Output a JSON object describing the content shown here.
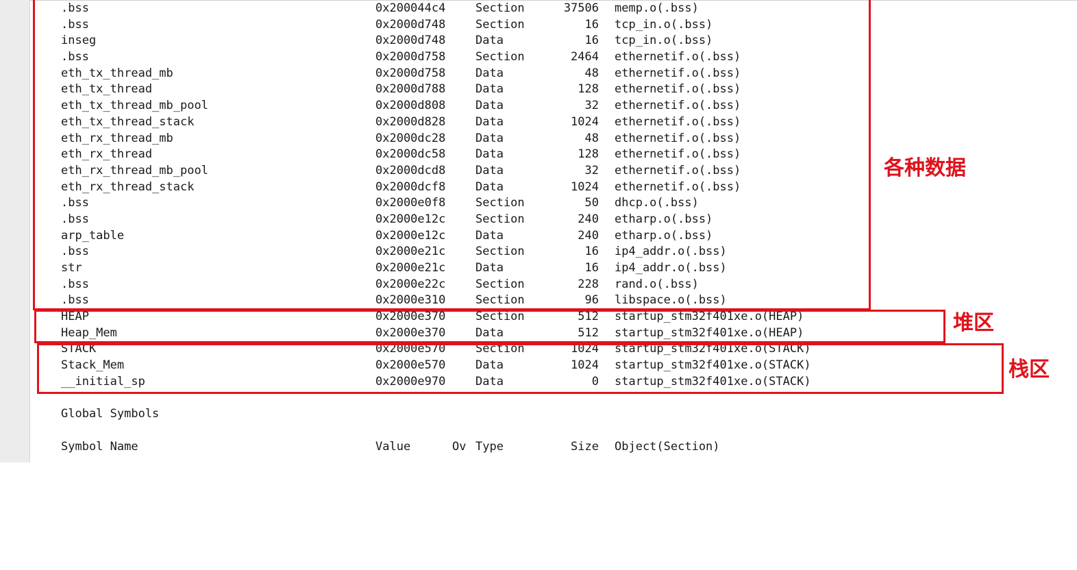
{
  "symbols": [
    {
      "name": ".bss",
      "value": "0x200044c4",
      "type": "Section",
      "size": "37506",
      "object": "memp.o(.bss)"
    },
    {
      "name": ".bss",
      "value": "0x2000d748",
      "type": "Section",
      "size": "16",
      "object": "tcp_in.o(.bss)"
    },
    {
      "name": "inseg",
      "value": "0x2000d748",
      "type": "Data",
      "size": "16",
      "object": "tcp_in.o(.bss)"
    },
    {
      "name": ".bss",
      "value": "0x2000d758",
      "type": "Section",
      "size": "2464",
      "object": "ethernetif.o(.bss)"
    },
    {
      "name": "eth_tx_thread_mb",
      "value": "0x2000d758",
      "type": "Data",
      "size": "48",
      "object": "ethernetif.o(.bss)"
    },
    {
      "name": "eth_tx_thread",
      "value": "0x2000d788",
      "type": "Data",
      "size": "128",
      "object": "ethernetif.o(.bss)"
    },
    {
      "name": "eth_tx_thread_mb_pool",
      "value": "0x2000d808",
      "type": "Data",
      "size": "32",
      "object": "ethernetif.o(.bss)"
    },
    {
      "name": "eth_tx_thread_stack",
      "value": "0x2000d828",
      "type": "Data",
      "size": "1024",
      "object": "ethernetif.o(.bss)"
    },
    {
      "name": "eth_rx_thread_mb",
      "value": "0x2000dc28",
      "type": "Data",
      "size": "48",
      "object": "ethernetif.o(.bss)"
    },
    {
      "name": "eth_rx_thread",
      "value": "0x2000dc58",
      "type": "Data",
      "size": "128",
      "object": "ethernetif.o(.bss)"
    },
    {
      "name": "eth_rx_thread_mb_pool",
      "value": "0x2000dcd8",
      "type": "Data",
      "size": "32",
      "object": "ethernetif.o(.bss)"
    },
    {
      "name": "eth_rx_thread_stack",
      "value": "0x2000dcf8",
      "type": "Data",
      "size": "1024",
      "object": "ethernetif.o(.bss)"
    },
    {
      "name": ".bss",
      "value": "0x2000e0f8",
      "type": "Section",
      "size": "50",
      "object": "dhcp.o(.bss)"
    },
    {
      "name": ".bss",
      "value": "0x2000e12c",
      "type": "Section",
      "size": "240",
      "object": "etharp.o(.bss)"
    },
    {
      "name": "arp_table",
      "value": "0x2000e12c",
      "type": "Data",
      "size": "240",
      "object": "etharp.o(.bss)"
    },
    {
      "name": ".bss",
      "value": "0x2000e21c",
      "type": "Section",
      "size": "16",
      "object": "ip4_addr.o(.bss)"
    },
    {
      "name": "str",
      "value": "0x2000e21c",
      "type": "Data",
      "size": "16",
      "object": "ip4_addr.o(.bss)"
    },
    {
      "name": ".bss",
      "value": "0x2000e22c",
      "type": "Section",
      "size": "228",
      "object": "rand.o(.bss)"
    },
    {
      "name": ".bss",
      "value": "0x2000e310",
      "type": "Section",
      "size": "96",
      "object": "libspace.o(.bss)"
    },
    {
      "name": "HEAP",
      "value": "0x2000e370",
      "type": "Section",
      "size": "512",
      "object": "startup_stm32f401xe.o(HEAP)"
    },
    {
      "name": "Heap_Mem",
      "value": "0x2000e370",
      "type": "Data",
      "size": "512",
      "object": "startup_stm32f401xe.o(HEAP)"
    },
    {
      "name": "STACK",
      "value": "0x2000e570",
      "type": "Section",
      "size": "1024",
      "object": "startup_stm32f401xe.o(STACK)"
    },
    {
      "name": "Stack_Mem",
      "value": "0x2000e570",
      "type": "Data",
      "size": "1024",
      "object": "startup_stm32f401xe.o(STACK)"
    },
    {
      "name": "__initial_sp",
      "value": "0x2000e970",
      "type": "Data",
      "size": "0",
      "object": "startup_stm32f401xe.o(STACK)"
    }
  ],
  "global_symbols": {
    "heading": "Global Symbols",
    "columns": {
      "name": "Symbol Name",
      "value": "Value",
      "ov": "Ov",
      "type": "Type",
      "size": "Size",
      "object": "Object(Section)"
    }
  },
  "annotations": {
    "data_region": "各种数据",
    "heap_region": "堆区",
    "stack_region": "栈区",
    "color": "#e0121c"
  }
}
